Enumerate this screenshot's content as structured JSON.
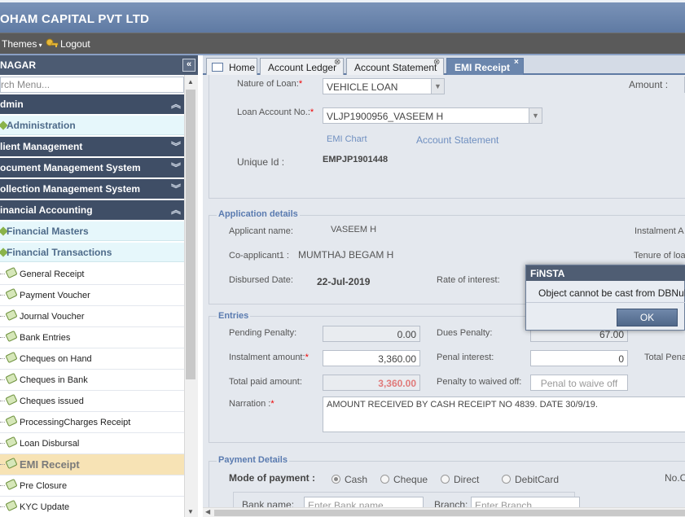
{
  "app": {
    "title": "OHAM CAPITAL PVT LTD"
  },
  "menubar": {
    "themes": "Themes",
    "logout": "Logout"
  },
  "sidebar": {
    "header": "NAGAR",
    "collapse_glyph": "«",
    "search_placeholder": "rch Menu...",
    "sections": {
      "admin": "dmin",
      "administration": "Administration",
      "client": "lient Management",
      "document": "ocument Management System",
      "collection": "ollection Management System",
      "financial": "inancial Accounting",
      "masters": "Financial Masters",
      "transactions": "Financial Transactions"
    },
    "items": [
      "General Receipt",
      "Payment Voucher",
      "Journal Voucher",
      "Bank Entries",
      "Cheques on Hand",
      "Cheques in Bank",
      "Cheques issued",
      "ProcessingCharges Receipt",
      "Loan Disbursal",
      "EMI Receipt",
      "Pre Closure",
      "KYC Update"
    ],
    "active_item": "EMI Receipt"
  },
  "tabs": {
    "home": "Home",
    "ledger": "Account Ledger",
    "statement": "Account Statement",
    "emi": "EMI Receipt",
    "active": "EMI Receipt"
  },
  "loan": {
    "nature_label": "Nature of Loan:",
    "nature_value": "VEHICLE LOAN",
    "amount_label": "Amount :",
    "account_label": "Loan Account No.:",
    "account_value": "VLJP1900956_VASEEM H",
    "emi_chart_link": "EMI Chart",
    "statement_link": "Account Statement",
    "unique_label": "Unique Id :",
    "unique_value": "EMPJP1901448"
  },
  "application": {
    "legend": "Application details",
    "applicant_label": "Applicant name:",
    "applicant_value": "VASEEM H",
    "instalment_label": "Instalment A",
    "coapplicant_label": "Co-applicant1 :",
    "coapplicant_value": "MUMTHAJ BEGAM H",
    "tenure_label": "Tenure of loa",
    "disbursed_label": "Disbursed Date:",
    "disbursed_value": "22-Jul-2019",
    "rate_label": "Rate of interest:"
  },
  "entries": {
    "legend": "Entries",
    "pending_penalty_label": "Pending Penalty:",
    "pending_penalty_value": "0.00",
    "dues_penalty_label": "Dues Penalty:",
    "dues_penalty_value": "67.00",
    "instalment_label": "Instalment amount:",
    "instalment_value": "3,360.00",
    "penal_interest_label": "Penal interest:",
    "penal_interest_value": "0",
    "total_penal_label": "Total Pena",
    "total_paid_label": "Total paid amount:",
    "total_paid_value": "3,360.00",
    "penalty_waived_label": "Penalty to waived off:",
    "penalty_waived_placeholder": "Penal to waive off",
    "narration_label": "Narration :",
    "narration_value": "AMOUNT RECEIVED BY CASH RECEIPT NO 4839. DATE 30/9/19."
  },
  "payment": {
    "legend": "Payment Details",
    "mode_label": "Mode of payment :",
    "modes": [
      "Cash",
      "Cheque",
      "Direct",
      "DebitCard"
    ],
    "selected_mode": "Cash",
    "no_label": "No.C",
    "bank_label": "Bank name:",
    "bank_placeholder": "Enter Bank name",
    "branch_label": "Branch:",
    "branch_placeholder": "Enter Branch"
  },
  "dialog": {
    "title": "FiNSTA",
    "message": "Object cannot be cast from DBNul",
    "ok": "OK"
  },
  "colors": {
    "header": "#5f7aa3",
    "active_tab": "#6b86ad",
    "active_item_bg": "#f7e3b5",
    "required": "#ee0000"
  },
  "icons": {
    "home": "home-icon",
    "logout": "key-icon",
    "close": "close-icon",
    "chevron": "chevron-icon",
    "tag": "tag-icon"
  }
}
